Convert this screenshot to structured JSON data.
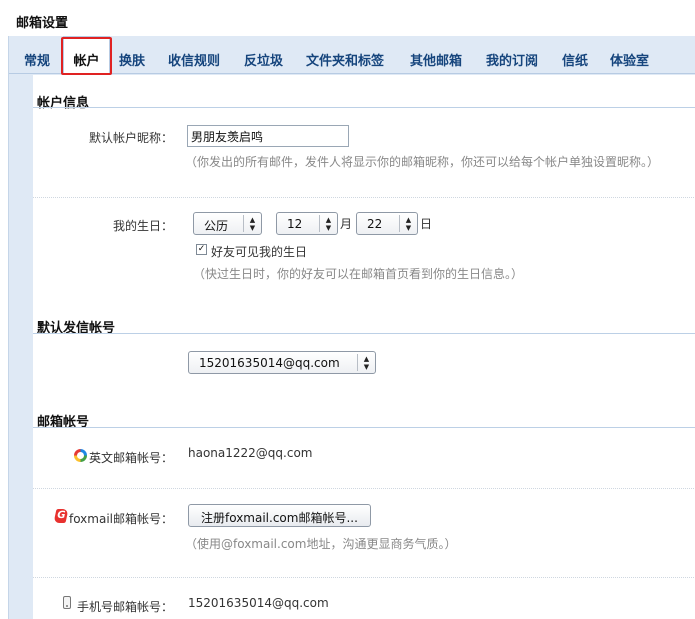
{
  "page_title": "邮箱设置",
  "tabs": [
    "常规",
    "帐户",
    "换肤",
    "收信规则",
    "反垃圾",
    "文件夹和标签",
    "其他邮箱",
    "我的订阅",
    "信纸",
    "体验室"
  ],
  "active_tab": "帐户",
  "account_info": {
    "section_title": "帐户信息",
    "nickname_label": "默认帐户昵称：",
    "nickname_value": "男朋友羡启鸣",
    "nickname_hint": "（你发出的所有邮件，发件人将显示你的邮箱昵称，你还可以给每个帐户单独设置昵称。）",
    "birthday_label": "我的生日：",
    "calendar_value": "公历",
    "month_value": "12",
    "month_unit": "月",
    "day_value": "22",
    "day_unit": "日",
    "birthday_checkbox_label": "好友可见我的生日",
    "birthday_checkbox_checked": true,
    "birthday_hint": "（快过生日时，你的好友可以在邮箱首页看到你的生日信息。）"
  },
  "default_sender": {
    "section_title": "默认发信帐号",
    "selected_value": "15201635014@qq.com"
  },
  "mail_accounts": {
    "section_title": "邮箱帐号",
    "english_label": "英文邮箱帐号：",
    "english_value": "haona1222@qq.com",
    "foxmail_label": "foxmail邮箱帐号：",
    "foxmail_button": "注册foxmail.com邮箱帐号...",
    "foxmail_hint": "（使用@foxmail.com地址，沟通更显商务气质。）",
    "mobile_label": "手机号邮箱帐号：",
    "mobile_value": "15201635014@qq.com"
  },
  "icons": {
    "qq": "qq-logo-icon",
    "foxmail": "foxmail-logo-icon",
    "mobile": "mobile-phone-icon",
    "checkmark": "✓",
    "dropdown": "▲▼"
  },
  "colors": {
    "tab_text": "#16457d",
    "panel_bg": "#dfe9f5",
    "highlight": "#e02222",
    "hint": "#888888"
  }
}
